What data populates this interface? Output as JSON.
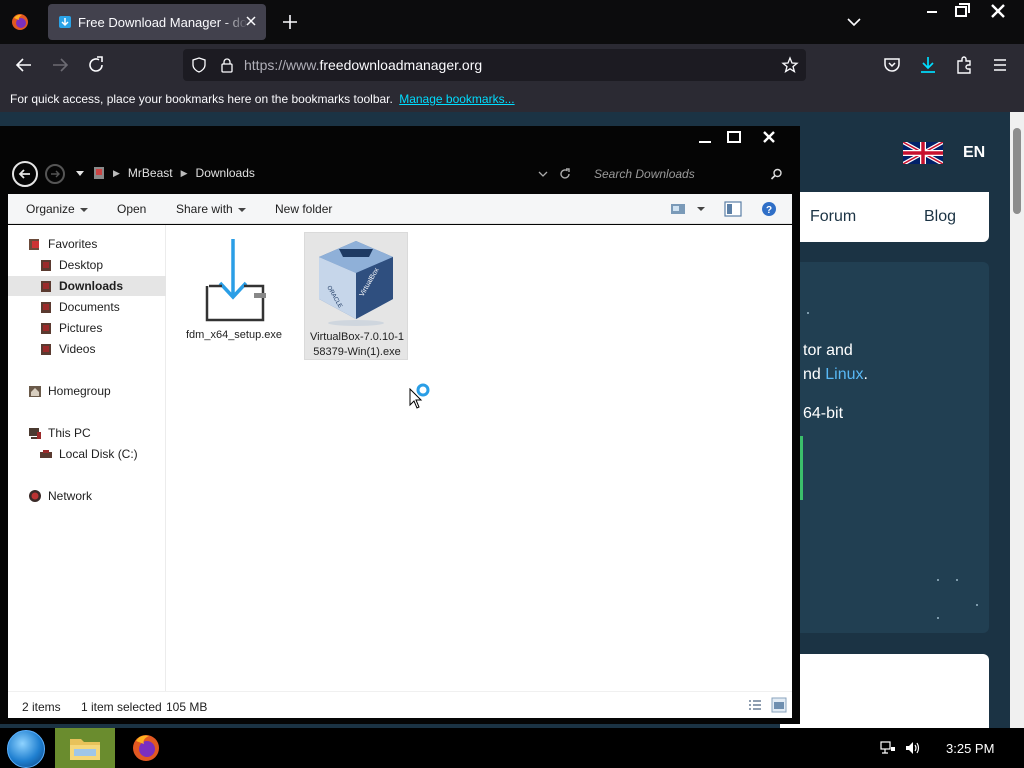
{
  "browser": {
    "tab": {
      "title": "Free Download Manager - download faster"
    },
    "url": {
      "host": "https://www.",
      "domain": "freedownloadmanager.org"
    },
    "bookmarks_bar": {
      "message": "For quick access, place your bookmarks here on the bookmarks toolbar.",
      "link": "Manage bookmarks..."
    }
  },
  "webpage": {
    "language": "EN",
    "nav": {
      "forum": "Forum",
      "blog": "Blog"
    },
    "hero": {
      "line1": "tor and",
      "line2_prefix": "nd ",
      "line2_link": "Linux",
      "line2_suffix": ".",
      "line3": "64-bit"
    }
  },
  "explorer": {
    "breadcrumb": [
      "MrBeast",
      "Downloads"
    ],
    "search_placeholder": "Search Downloads",
    "toolbar": {
      "organize": "Organize",
      "open": "Open",
      "share_with": "Share with",
      "new_folder": "New folder"
    },
    "sidebar": {
      "favorites": "Favorites",
      "desktop": "Desktop",
      "downloads": "Downloads",
      "documents": "Documents",
      "pictures": "Pictures",
      "videos": "Videos",
      "homegroup": "Homegroup",
      "this_pc": "This PC",
      "local_disk": "Local Disk (C:)",
      "network": "Network"
    },
    "files": [
      {
        "name": "fdm_x64_setup.exe",
        "selected": false,
        "icon": "download-installer-icon"
      },
      {
        "name": "VirtualBox-7.0.10-158379-Win(1).exe",
        "selected": true,
        "icon": "virtualbox-icon"
      }
    ],
    "status": {
      "items": "2 items",
      "selected": "1 item selected",
      "size": "105 MB"
    }
  },
  "taskbar": {
    "time": "3:25 PM"
  },
  "colors": {
    "link": "#00ddff",
    "page_bg": "#1b3344",
    "hero_link": "#58b8f5",
    "taskbar_active": "#6a8c2e"
  }
}
